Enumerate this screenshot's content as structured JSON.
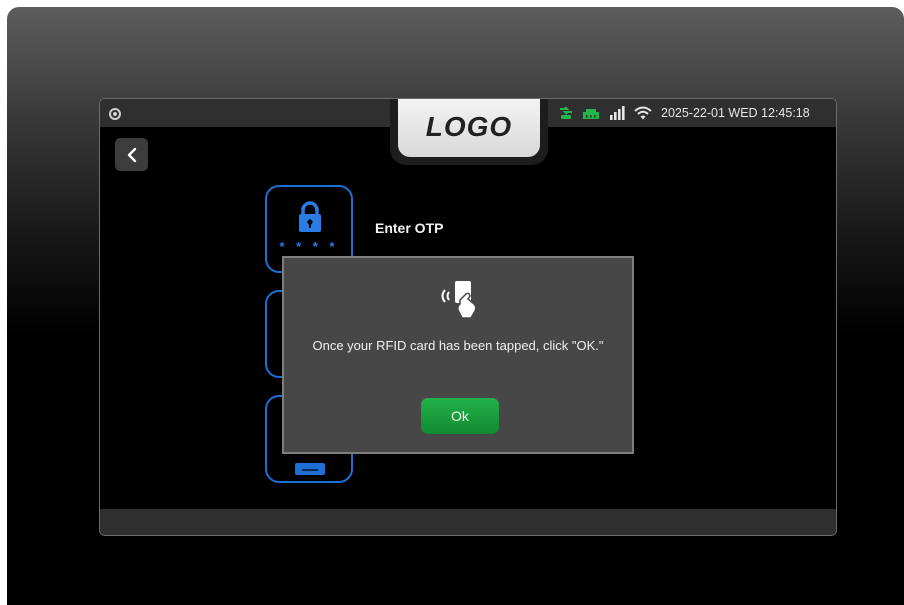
{
  "header": {
    "logo_text": "LOGO",
    "datetime": "2025-22-01 WED 12:45:18",
    "status_icons": [
      "camera-icon",
      "cloud-sync-icon",
      "ethernet-icon",
      "signal-bars-icon",
      "wifi-icon"
    ]
  },
  "navigation": {
    "back_icon": "chevron-left-icon"
  },
  "options": [
    {
      "label": "Enter OTP",
      "icon": "lock-icon",
      "otp_mask": "* * * *"
    },
    {
      "icon": "rfid-card-icon"
    },
    {
      "icon": "card-icon"
    }
  ],
  "dialog": {
    "icon": "rfid-tap-icon",
    "message": "Once your RFID card has been tapped, click \"OK.\"",
    "ok_label": "Ok"
  },
  "colors": {
    "accent_blue": "#1f6ed4",
    "ok_green": "#1a9e3f",
    "status_green": "#25b34b",
    "dialog_bg": "#474747"
  }
}
